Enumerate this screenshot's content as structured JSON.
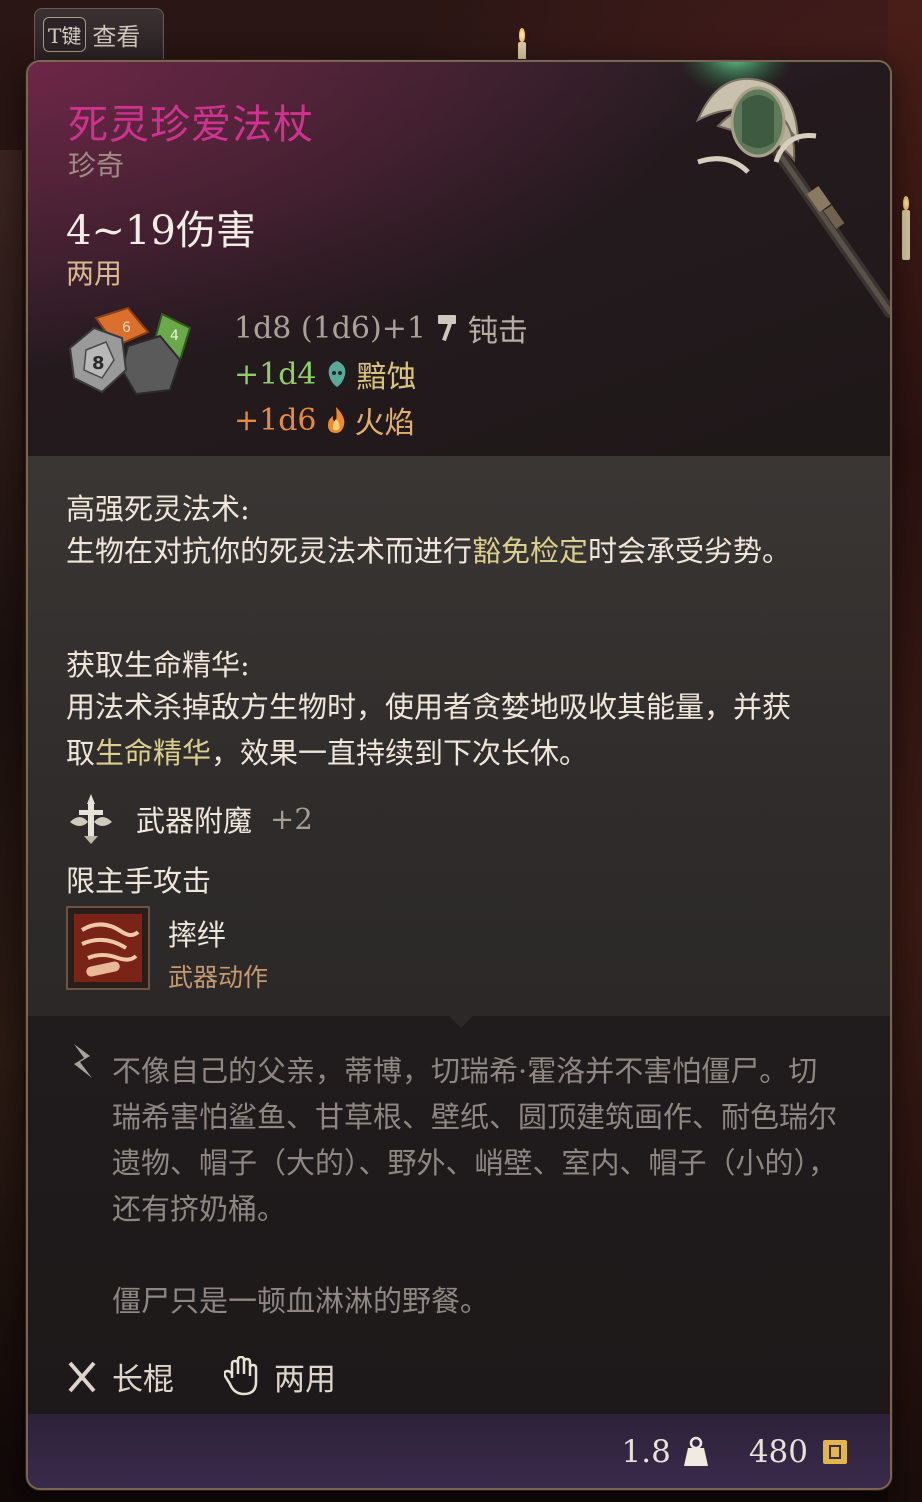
{
  "hotkey": {
    "key": "T键",
    "label": "查看"
  },
  "item": {
    "name": "死灵珍爱法杖",
    "rarity": "珍奇",
    "damage": "4~19伤害",
    "handedness": "两用",
    "damage_lines": [
      {
        "dice": "1d8 (1d6)+1",
        "type": "钝击",
        "icon": "hammer-icon"
      },
      {
        "dice": "+1d4",
        "type": "黯蚀",
        "icon": "necrotic-skull-icon"
      },
      {
        "dice": "+1d6",
        "type": "火焰",
        "icon": "flame-icon"
      }
    ],
    "passives": [
      {
        "title": "高强死灵法术:",
        "text_before": "生物在对抗你的死灵法术而进行",
        "highlight": "豁免检定",
        "text_after": "时会承受劣势。"
      },
      {
        "title": "获取生命精华:",
        "text_before": "用法术杀掉敌方生物时，使用者贪婪地吸收其能量，并获取",
        "highlight": "生命精华",
        "text_after": "，效果一直持续到下次长休。"
      }
    ],
    "enchantment": {
      "label": "武器附魔",
      "value": "+2"
    },
    "restriction": "限主手攻击",
    "weapon_action": {
      "name": "摔绊",
      "type": "武器动作"
    },
    "lore": [
      "不像自己的父亲，蒂博，切瑞希·霍洛并不害怕僵尸。切瑞希害怕鲨鱼、甘草根、壁纸、圆顶建筑画作、耐色瑞尔遗物、帽子（大的）、野外、峭壁、室内、帽子（小的），还有挤奶桶。",
      "僵尸只是一顿血淋淋的野餐。"
    ],
    "properties": [
      {
        "label": "长棍",
        "icon": "quarterstaff-icon"
      },
      {
        "label": "两用",
        "icon": "hand-icon"
      }
    ],
    "weight": "1.8",
    "value": "480"
  },
  "colors": {
    "title": "#d0338f",
    "slashing": "#aaa29a",
    "necrotic": "#8ecf6a",
    "fire": "#e88a3e",
    "highlight": "#dccf8e"
  }
}
